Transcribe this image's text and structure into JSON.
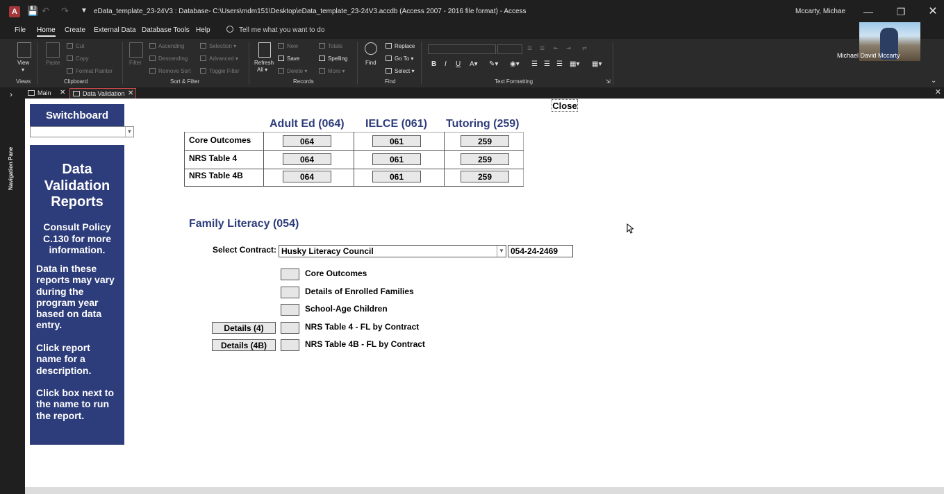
{
  "window": {
    "title": "eData_template_23-24V3 : Database- C:\\Users\\mdm151\\Desktop\\eData_template_23-24V3.accdb (Access 2007 - 2016 file format)  -  Access",
    "user": "Mccarty, Michae",
    "webcam_name": "Michael David Mccarty"
  },
  "menu": {
    "tabs": [
      "File",
      "Home",
      "Create",
      "External Data",
      "Database Tools",
      "Help"
    ],
    "tell_me": "Tell me what you want to do"
  },
  "ribbon": {
    "views": {
      "label": "Views",
      "view": "View"
    },
    "clipboard": {
      "label": "Clipboard",
      "paste": "Paste",
      "cut": "Cut",
      "copy": "Copy",
      "format_painter": "Format Painter"
    },
    "sort_filter": {
      "label": "Sort & Filter",
      "filter": "Filter",
      "ascending": "Ascending",
      "descending": "Descending",
      "remove_sort": "Remove Sort",
      "selection": "Selection",
      "advanced": "Advanced",
      "toggle_filter": "Toggle Filter"
    },
    "records": {
      "label": "Records",
      "refresh": "Refresh",
      "refresh_all": "All",
      "new": "New",
      "save": "Save",
      "delete": "Delete",
      "totals": "Totals",
      "spelling": "Spelling",
      "more": "More"
    },
    "find": {
      "label": "Find",
      "find": "Find",
      "replace": "Replace",
      "goto": "Go To",
      "select": "Select"
    },
    "text_formatting": {
      "label": "Text Formatting",
      "bold": "B",
      "italic": "I",
      "underline": "U"
    }
  },
  "navpane": {
    "label": "Navigation Pane"
  },
  "doc_tabs": [
    {
      "label": "Main",
      "active": false
    },
    {
      "label": "Data Validation",
      "active": true
    }
  ],
  "form": {
    "switchboard": "Switchboard",
    "switch_combo_value": "",
    "info": {
      "title": [
        "Data",
        "Validation",
        "Reports"
      ],
      "policy": [
        "Consult Policy",
        "C.130 for more",
        "information."
      ],
      "p1": [
        "Data in these",
        "reports may vary",
        "during the",
        "program year",
        "based on data",
        "entry."
      ],
      "p2": [
        "Click report",
        "name for a",
        "description."
      ],
      "p3": [
        "Click box next to",
        "the name to run",
        "the report."
      ]
    },
    "close": "Close",
    "columns": [
      "Adult Ed (064)",
      "IELCE (061)",
      "Tutoring (259)"
    ],
    "rows": [
      {
        "label": "Core Outcomes",
        "values": [
          "064",
          "061",
          "259"
        ]
      },
      {
        "label": "NRS Table 4",
        "values": [
          "064",
          "061",
          "259"
        ]
      },
      {
        "label": "NRS Table 4B",
        "values": [
          "064",
          "061",
          "259"
        ]
      }
    ],
    "family_literacy": {
      "heading": "Family Literacy (054)",
      "select_label": "Select Contract:",
      "contract": "Husky Literacy Council",
      "contract_code": "054-24-2469",
      "reports": [
        {
          "label": "Core Outcomes",
          "button": ""
        },
        {
          "label": "Details of Enrolled Families",
          "button": ""
        },
        {
          "label": "School-Age Children",
          "button": ""
        },
        {
          "label": "NRS Table 4 - FL by Contract",
          "button": "Details (4)"
        },
        {
          "label": "NRS Table 4B - FL by Contract",
          "button": "Details (4B)"
        }
      ]
    }
  }
}
